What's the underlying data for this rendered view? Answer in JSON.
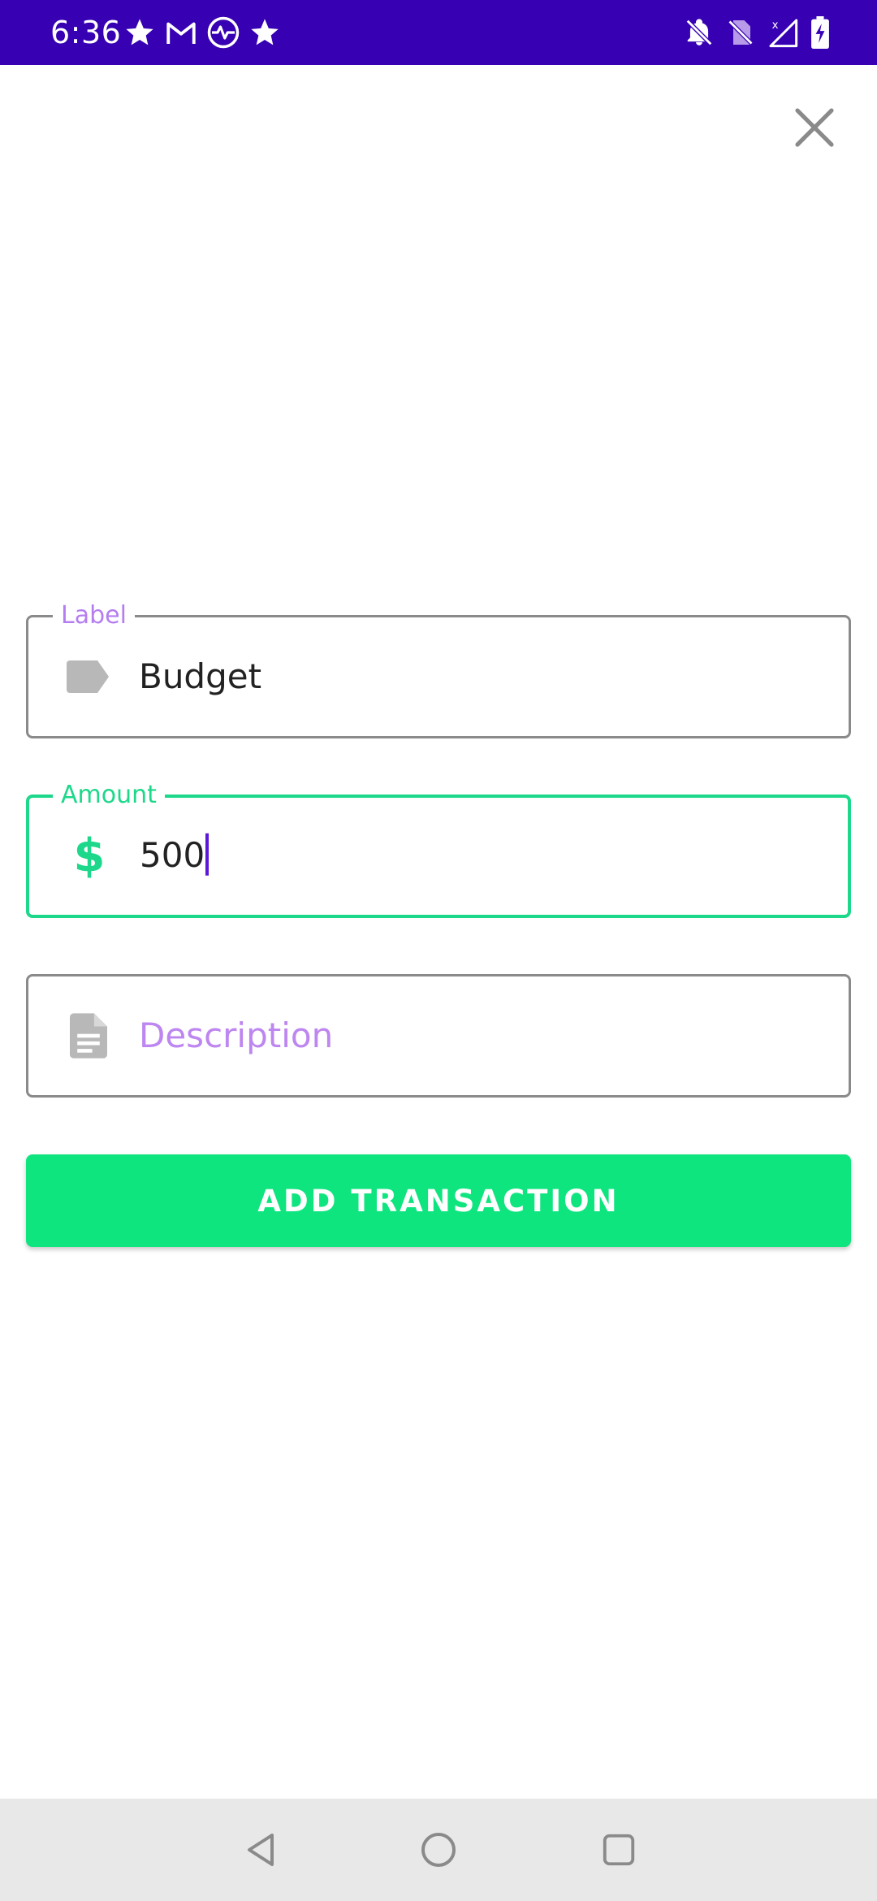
{
  "status_bar": {
    "time": "6:36",
    "left_icons": [
      "star-icon",
      "gmail-icon",
      "activity-icon",
      "star-icon"
    ],
    "right_icons": [
      "bell-off-icon",
      "no-sim-icon",
      "signal-icon",
      "battery-charging-icon"
    ]
  },
  "toolbar": {
    "close_icon": "close-icon"
  },
  "form": {
    "label_field": {
      "label": "Label",
      "value": "Budget",
      "icon": "tag-icon"
    },
    "amount_field": {
      "label": "Amount",
      "value": "500",
      "icon": "dollar-icon",
      "icon_text": "$"
    },
    "description_field": {
      "placeholder": "Description",
      "icon": "document-icon"
    },
    "submit_label": "ADD TRANSACTION"
  },
  "colors": {
    "status_bar": "#3700b3",
    "accent_green": "#1dd88a",
    "button_green": "#0fe57f",
    "label_purple": "#b57ef0",
    "caret": "#5b18d6"
  },
  "nav_bar": {
    "buttons": [
      "back-icon",
      "home-icon",
      "recents-icon"
    ]
  }
}
